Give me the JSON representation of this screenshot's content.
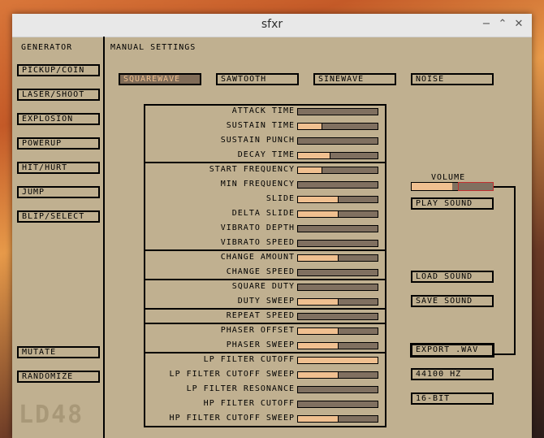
{
  "window": {
    "title": "sfxr"
  },
  "generator": {
    "heading": "GENERATOR",
    "buttons": [
      "PICKUP/COIN",
      "LASER/SHOOT",
      "EXPLOSION",
      "POWERUP",
      "HIT/HURT",
      "JUMP",
      "BLIP/SELECT"
    ],
    "mutate": "MUTATE",
    "randomize": "RANDOMIZE",
    "logo": "LD48"
  },
  "manual": {
    "heading": "MANUAL SETTINGS",
    "waves": [
      "SQUAREWAVE",
      "SAWTOOTH",
      "SINEWAVE",
      "NOISE"
    ],
    "selected_wave": "SQUAREWAVE"
  },
  "params": [
    {
      "label": "ATTACK TIME",
      "value": 0.0
    },
    {
      "label": "SUSTAIN TIME",
      "value": 0.3
    },
    {
      "label": "SUSTAIN PUNCH",
      "value": 0.0
    },
    {
      "label": "DECAY TIME",
      "value": 0.4
    },
    {
      "label": "START FREQUENCY",
      "value": 0.3
    },
    {
      "label": "MIN FREQUENCY",
      "value": 0.0
    },
    {
      "label": "SLIDE",
      "value": 0.5
    },
    {
      "label": "DELTA SLIDE",
      "value": 0.5
    },
    {
      "label": "VIBRATO DEPTH",
      "value": 0.0
    },
    {
      "label": "VIBRATO SPEED",
      "value": 0.0
    },
    {
      "label": "CHANGE AMOUNT",
      "value": 0.5
    },
    {
      "label": "CHANGE SPEED",
      "value": 0.0
    },
    {
      "label": "SQUARE DUTY",
      "value": 0.0
    },
    {
      "label": "DUTY SWEEP",
      "value": 0.5
    },
    {
      "label": "REPEAT SPEED",
      "value": 0.0
    },
    {
      "label": "PHASER OFFSET",
      "value": 0.5
    },
    {
      "label": "PHASER SWEEP",
      "value": 0.5
    },
    {
      "label": "LP FILTER CUTOFF",
      "value": 1.0
    },
    {
      "label": "LP FILTER CUTOFF SWEEP",
      "value": 0.5
    },
    {
      "label": "LP FILTER RESONANCE",
      "value": 0.0
    },
    {
      "label": "HP FILTER CUTOFF",
      "value": 0.0
    },
    {
      "label": "HP FILTER CUTOFF SWEEP",
      "value": 0.5
    }
  ],
  "right": {
    "volume_label": "VOLUME",
    "volume": 0.5,
    "play": "PLAY SOUND",
    "load": "LOAD SOUND",
    "save": "SAVE SOUND",
    "export": "EXPORT .WAV",
    "rate": "44100 HZ",
    "bits": "16-BIT"
  },
  "colors": {
    "panel": "#c0b090",
    "slider_bg": "#807060",
    "slider_fill": "#f0c090",
    "volume_marker": "#c03030"
  }
}
